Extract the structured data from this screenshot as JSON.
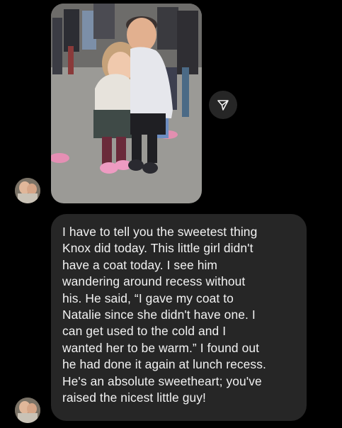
{
  "thread": {
    "photo_message": {
      "alt": "Photo of a boy and a girl hugging on a school playground",
      "share_icon": "paper-plane-icon"
    },
    "sender_avatar_icon": "avatar-photo",
    "text_message": {
      "lines": [
        "I have to tell you the sweetest thing",
        "Knox did today. This little girl didn't",
        "have a coat today. I see him",
        "wandering around recess without",
        "his. He said, “I gave my coat to",
        "Natalie since she didn't have one. I",
        "can get used to the cold and I",
        "wanted her to be warm.” I found out",
        "he had done it again at lunch recess.",
        "He's an absolute sweetheart; you've",
        "raised the nicest little guy!"
      ]
    },
    "colors": {
      "background": "#000000",
      "bubble": "#262626",
      "text": "#f2f2f2"
    }
  }
}
